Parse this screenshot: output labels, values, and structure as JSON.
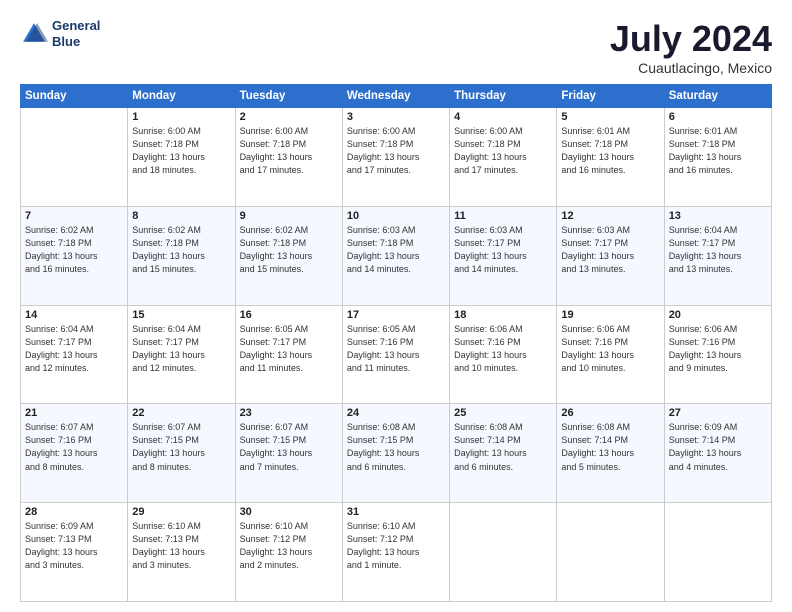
{
  "header": {
    "logo": {
      "line1": "General",
      "line2": "Blue"
    },
    "title": "July 2024",
    "subtitle": "Cuautlacingo, Mexico"
  },
  "weekdays": [
    "Sunday",
    "Monday",
    "Tuesday",
    "Wednesday",
    "Thursday",
    "Friday",
    "Saturday"
  ],
  "weeks": [
    [
      {
        "day": "",
        "info": ""
      },
      {
        "day": "1",
        "info": "Sunrise: 6:00 AM\nSunset: 7:18 PM\nDaylight: 13 hours\nand 18 minutes."
      },
      {
        "day": "2",
        "info": "Sunrise: 6:00 AM\nSunset: 7:18 PM\nDaylight: 13 hours\nand 17 minutes."
      },
      {
        "day": "3",
        "info": "Sunrise: 6:00 AM\nSunset: 7:18 PM\nDaylight: 13 hours\nand 17 minutes."
      },
      {
        "day": "4",
        "info": "Sunrise: 6:00 AM\nSunset: 7:18 PM\nDaylight: 13 hours\nand 17 minutes."
      },
      {
        "day": "5",
        "info": "Sunrise: 6:01 AM\nSunset: 7:18 PM\nDaylight: 13 hours\nand 16 minutes."
      },
      {
        "day": "6",
        "info": "Sunrise: 6:01 AM\nSunset: 7:18 PM\nDaylight: 13 hours\nand 16 minutes."
      }
    ],
    [
      {
        "day": "7",
        "info": "Sunrise: 6:02 AM\nSunset: 7:18 PM\nDaylight: 13 hours\nand 16 minutes."
      },
      {
        "day": "8",
        "info": "Sunrise: 6:02 AM\nSunset: 7:18 PM\nDaylight: 13 hours\nand 15 minutes."
      },
      {
        "day": "9",
        "info": "Sunrise: 6:02 AM\nSunset: 7:18 PM\nDaylight: 13 hours\nand 15 minutes."
      },
      {
        "day": "10",
        "info": "Sunrise: 6:03 AM\nSunset: 7:18 PM\nDaylight: 13 hours\nand 14 minutes."
      },
      {
        "day": "11",
        "info": "Sunrise: 6:03 AM\nSunset: 7:17 PM\nDaylight: 13 hours\nand 14 minutes."
      },
      {
        "day": "12",
        "info": "Sunrise: 6:03 AM\nSunset: 7:17 PM\nDaylight: 13 hours\nand 13 minutes."
      },
      {
        "day": "13",
        "info": "Sunrise: 6:04 AM\nSunset: 7:17 PM\nDaylight: 13 hours\nand 13 minutes."
      }
    ],
    [
      {
        "day": "14",
        "info": "Sunrise: 6:04 AM\nSunset: 7:17 PM\nDaylight: 13 hours\nand 12 minutes."
      },
      {
        "day": "15",
        "info": "Sunrise: 6:04 AM\nSunset: 7:17 PM\nDaylight: 13 hours\nand 12 minutes."
      },
      {
        "day": "16",
        "info": "Sunrise: 6:05 AM\nSunset: 7:17 PM\nDaylight: 13 hours\nand 11 minutes."
      },
      {
        "day": "17",
        "info": "Sunrise: 6:05 AM\nSunset: 7:16 PM\nDaylight: 13 hours\nand 11 minutes."
      },
      {
        "day": "18",
        "info": "Sunrise: 6:06 AM\nSunset: 7:16 PM\nDaylight: 13 hours\nand 10 minutes."
      },
      {
        "day": "19",
        "info": "Sunrise: 6:06 AM\nSunset: 7:16 PM\nDaylight: 13 hours\nand 10 minutes."
      },
      {
        "day": "20",
        "info": "Sunrise: 6:06 AM\nSunset: 7:16 PM\nDaylight: 13 hours\nand 9 minutes."
      }
    ],
    [
      {
        "day": "21",
        "info": "Sunrise: 6:07 AM\nSunset: 7:16 PM\nDaylight: 13 hours\nand 8 minutes."
      },
      {
        "day": "22",
        "info": "Sunrise: 6:07 AM\nSunset: 7:15 PM\nDaylight: 13 hours\nand 8 minutes."
      },
      {
        "day": "23",
        "info": "Sunrise: 6:07 AM\nSunset: 7:15 PM\nDaylight: 13 hours\nand 7 minutes."
      },
      {
        "day": "24",
        "info": "Sunrise: 6:08 AM\nSunset: 7:15 PM\nDaylight: 13 hours\nand 6 minutes."
      },
      {
        "day": "25",
        "info": "Sunrise: 6:08 AM\nSunset: 7:14 PM\nDaylight: 13 hours\nand 6 minutes."
      },
      {
        "day": "26",
        "info": "Sunrise: 6:08 AM\nSunset: 7:14 PM\nDaylight: 13 hours\nand 5 minutes."
      },
      {
        "day": "27",
        "info": "Sunrise: 6:09 AM\nSunset: 7:14 PM\nDaylight: 13 hours\nand 4 minutes."
      }
    ],
    [
      {
        "day": "28",
        "info": "Sunrise: 6:09 AM\nSunset: 7:13 PM\nDaylight: 13 hours\nand 3 minutes."
      },
      {
        "day": "29",
        "info": "Sunrise: 6:10 AM\nSunset: 7:13 PM\nDaylight: 13 hours\nand 3 minutes."
      },
      {
        "day": "30",
        "info": "Sunrise: 6:10 AM\nSunset: 7:12 PM\nDaylight: 13 hours\nand 2 minutes."
      },
      {
        "day": "31",
        "info": "Sunrise: 6:10 AM\nSunset: 7:12 PM\nDaylight: 13 hours\nand 1 minute."
      },
      {
        "day": "",
        "info": ""
      },
      {
        "day": "",
        "info": ""
      },
      {
        "day": "",
        "info": ""
      }
    ]
  ]
}
